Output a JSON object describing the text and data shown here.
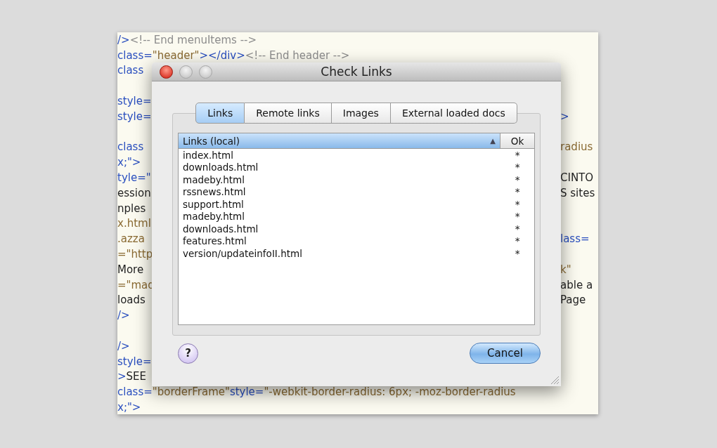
{
  "editor": {
    "blocks": [
      [
        {
          "left": [
            {
              "kind": "tag",
              "text": "/>"
            },
            {
              "kind": "comment",
              "text": "<!-- End menuItems -->"
            }
          ]
        },
        {
          "left": [
            {
              "kind": "attr",
              "text": "class="
            },
            {
              "kind": "string",
              "text": "\"header\""
            },
            {
              "kind": "tag",
              "text": "></div>"
            },
            {
              "kind": "comment",
              "text": "<!-- End header -->"
            }
          ]
        },
        {
          "left": [
            {
              "kind": "attr",
              "text": "class"
            }
          ]
        }
      ],
      [
        {
          "left": [
            {
              "kind": "attr",
              "text": "style="
            }
          ]
        },
        {
          "left": [
            {
              "kind": "attr",
              "text": "style="
            }
          ],
          "right": [
            {
              "kind": "tag",
              "text": ">"
            }
          ]
        }
      ],
      [
        {
          "left": [
            {
              "kind": "attr",
              "text": "class"
            }
          ],
          "right": [
            {
              "kind": "string",
              "text": "radius"
            }
          ]
        },
        {
          "left": [
            {
              "kind": "tag",
              "text": "x;\">"
            }
          ]
        },
        {
          "left": [
            {
              "kind": "attr",
              "text": "tyle=\""
            }
          ],
          "right": [
            {
              "kind": "text",
              "text": "CINTO"
            }
          ]
        },
        {
          "left": [
            {
              "kind": "text",
              "text": "ession"
            }
          ],
          "right": [
            {
              "kind": "text",
              "text": "S sites"
            }
          ]
        },
        {
          "left": [
            {
              "kind": "text",
              "text": "nples"
            }
          ]
        },
        {
          "left": [
            {
              "kind": "string",
              "text": "x.html"
            }
          ]
        },
        {
          "left": [
            {
              "kind": "string",
              "text": ".azza"
            }
          ],
          "right": [
            {
              "kind": "attr",
              "text": "lass="
            }
          ]
        },
        {
          "left": [
            {
              "kind": "string",
              "text": "=\"http"
            }
          ]
        },
        {
          "left": [
            {
              "kind": "text",
              "text": "More"
            }
          ],
          "right": [
            {
              "kind": "string",
              "text": "k\""
            }
          ]
        },
        {
          "left": [
            {
              "kind": "string",
              "text": "=\"mad"
            }
          ],
          "right": [
            {
              "kind": "text",
              "text": "able a"
            }
          ]
        },
        {
          "left": [
            {
              "kind": "text",
              "text": "loads"
            }
          ],
          "right": [
            {
              "kind": "text",
              "text": "Page"
            }
          ]
        },
        {
          "left": [
            {
              "kind": "tag",
              "text": "/>"
            }
          ]
        }
      ],
      [
        {
          "left": [
            {
              "kind": "tag",
              "text": "/>"
            }
          ]
        },
        {
          "left": [
            {
              "kind": "attr",
              "text": "style="
            }
          ]
        },
        {
          "left": [
            {
              "kind": "tag",
              "text": ">"
            },
            {
              "kind": "text",
              "text": "SEE"
            }
          ]
        },
        {
          "left": [
            {
              "kind": "attr",
              "text": "class="
            },
            {
              "kind": "string",
              "text": "\"borderFrame\""
            },
            {
              "kind": "attr",
              "text": " style="
            },
            {
              "kind": "string",
              "text": "\"-webkit-border-radius: 6px; -moz-border-radius"
            }
          ]
        },
        {
          "left": [
            {
              "kind": "tag",
              "text": "x;\">"
            }
          ]
        }
      ]
    ]
  },
  "dialog": {
    "title": "Check Links",
    "tabs": [
      {
        "label": "Links",
        "selected": true
      },
      {
        "label": "Remote links",
        "selected": false
      },
      {
        "label": "Images",
        "selected": false
      },
      {
        "label": "External loaded docs",
        "selected": false
      }
    ],
    "table": {
      "columns": [
        {
          "label": "Links (local)",
          "selected": true,
          "sort": "▲"
        },
        {
          "label": "Ok",
          "selected": false
        }
      ],
      "rows": [
        {
          "link": "index.html",
          "ok": "*"
        },
        {
          "link": "downloads.html",
          "ok": "*"
        },
        {
          "link": "madeby.html",
          "ok": "*"
        },
        {
          "link": "rssnews.html",
          "ok": "*"
        },
        {
          "link": "support.html",
          "ok": "*"
        },
        {
          "link": "madeby.html",
          "ok": "*"
        },
        {
          "link": "downloads.html",
          "ok": "*"
        },
        {
          "link": "features.html",
          "ok": "*"
        },
        {
          "link": "version/updateinfoII.html",
          "ok": "*"
        }
      ]
    },
    "help": "?",
    "buttons": [
      "Cancel"
    ]
  }
}
